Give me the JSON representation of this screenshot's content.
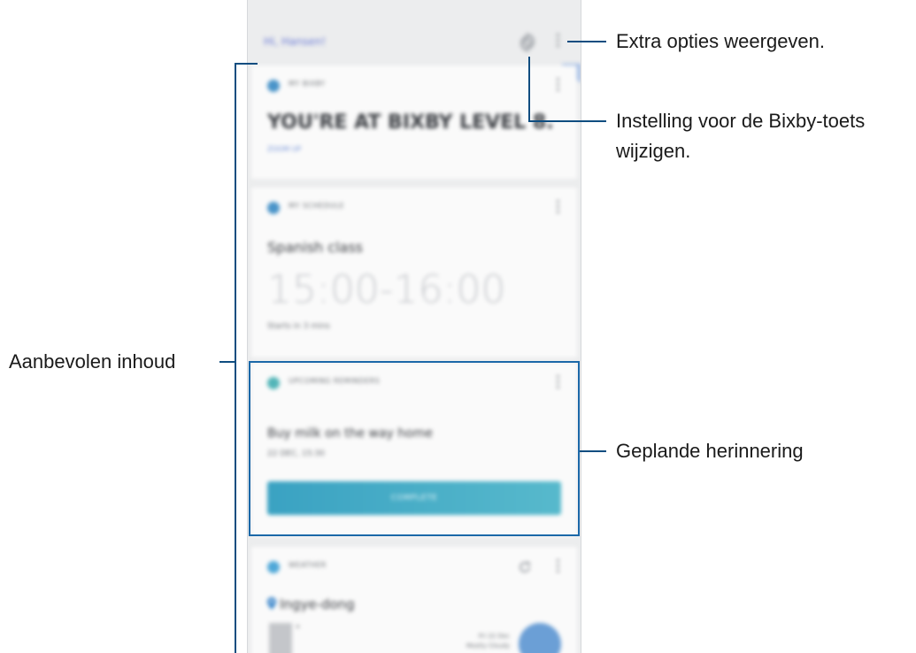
{
  "callouts": {
    "extra_options": "Extra opties weergeven.",
    "bixby_key_line1": "Instelling voor de Bixby-toets",
    "bixby_key_line2": "wijzigen.",
    "recommended": "Aanbevolen inhoud",
    "reminder": "Geplande herinnering"
  },
  "screen": {
    "greeting": "Hi, Hansen!",
    "cards": {
      "bixby": {
        "label": "MY BIXBY",
        "headline": "YOU'RE AT BIXBY LEVEL 8.",
        "sub": "ZOOM UP"
      },
      "schedule": {
        "label": "MY SCHEDULE",
        "event": "Spanish class",
        "time": "15:00-16:00",
        "starts": "Starts in 3 mins"
      },
      "reminder": {
        "label": "UPCOMING REMINDERS",
        "text": "Buy milk on the way home",
        "date": "22 DEC, 15:30",
        "button": "COMPLETE"
      },
      "weather": {
        "label": "WEATHER",
        "location": "Ingye-dong",
        "degree": "°",
        "info_line1": "Fri 22 Dec",
        "info_line2": "Mostly Cloudy"
      }
    }
  },
  "colors": {
    "callout_line": "#0f4d80",
    "highlight": "#1b68a8",
    "complete_button": "#3aa2c2"
  }
}
